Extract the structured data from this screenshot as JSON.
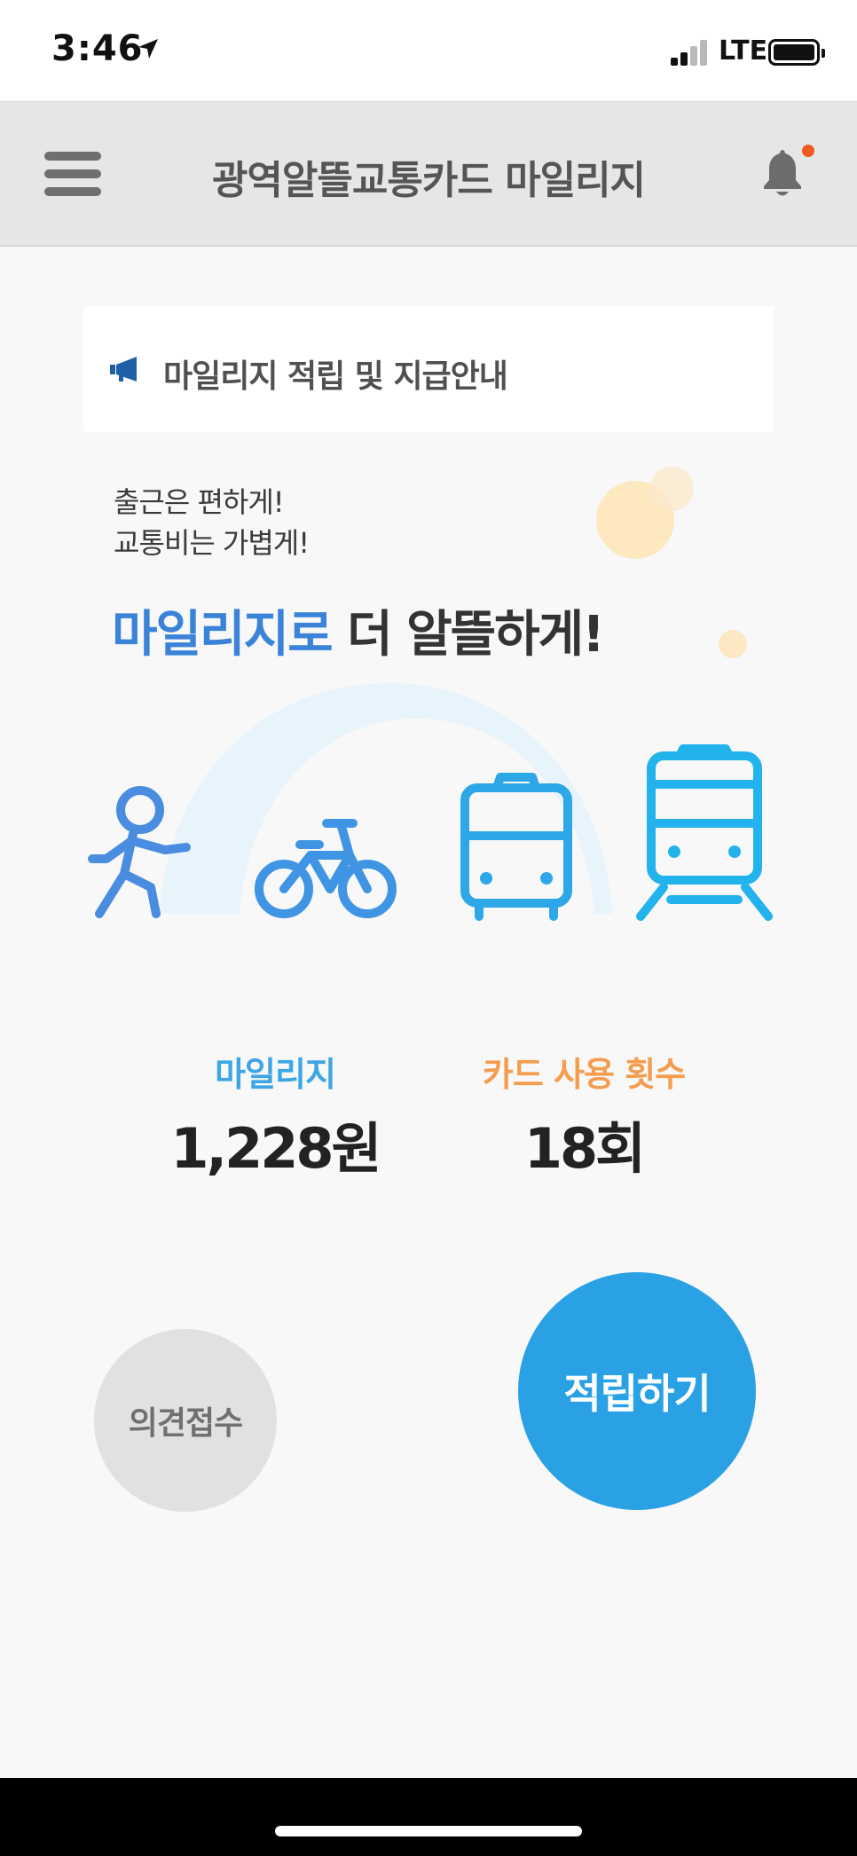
{
  "status_bar": {
    "time": "3:46",
    "network": "LTE",
    "signal_bars": 2,
    "signal_bars_total": 4,
    "battery_level": 1.0
  },
  "header": {
    "title": "광역알뜰교통카드 마일리지",
    "menu_icon": "hamburger-menu-icon",
    "notification_icon": "bell-icon",
    "has_unread_notification": true
  },
  "notice": {
    "icon": "megaphone-icon",
    "text": "마일리지 적립 및 지급안내"
  },
  "promo": {
    "line1": "출근은 편하게!",
    "line2": "교통비는 가볍게!",
    "headline_highlight": "마일리지로",
    "headline_rest": "더 알뜰하게!"
  },
  "illustration": {
    "icons": [
      "walking-person-icon",
      "bicycle-icon",
      "bus-icon",
      "train-icon"
    ]
  },
  "stats": {
    "mileage_label": "마일리지",
    "mileage_value": "1,228원",
    "usage_label": "카드 사용 횟수",
    "usage_value": "18회"
  },
  "actions": {
    "feedback_label": "의견접수",
    "accrue_label": "적립하기"
  },
  "colors": {
    "primary_blue": "#2aa1e4",
    "headline_blue": "#3b83d9",
    "usage_orange": "#f49d4f",
    "mileage_label_blue": "#3ea6e3",
    "notification_dot": "#f05a22"
  }
}
